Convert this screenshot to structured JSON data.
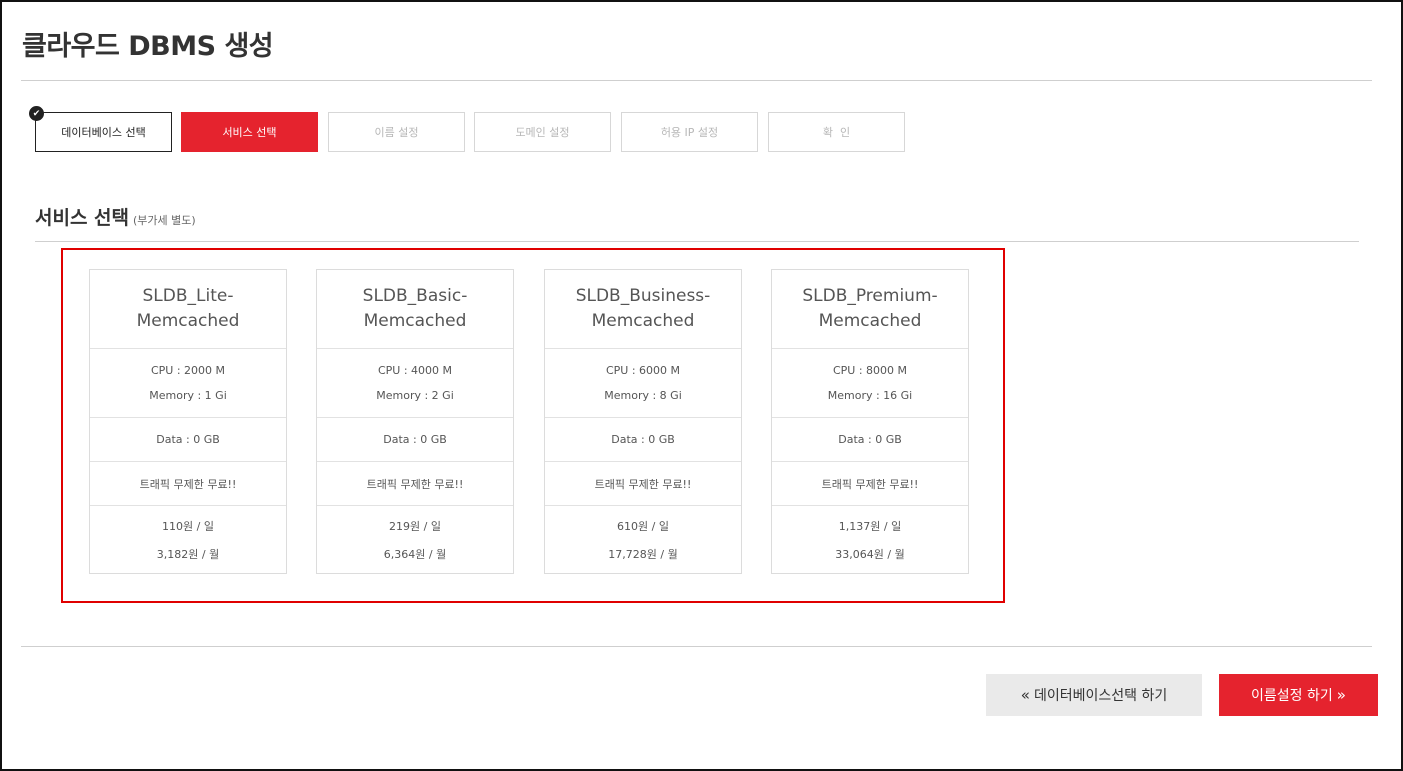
{
  "page": {
    "title": "클라우드 DBMS 생성",
    "accent_color": "#e5232e"
  },
  "steps": [
    {
      "label": "데이터베이스 선택",
      "state": "done"
    },
    {
      "label": "서비스 선택",
      "state": "active"
    },
    {
      "label": "이름 설정",
      "state": "pending"
    },
    {
      "label": "도메인 설정",
      "state": "pending"
    },
    {
      "label": "허용 IP 설정",
      "state": "pending"
    },
    {
      "label": "확  인",
      "state": "pending"
    }
  ],
  "section": {
    "title": "서비스 선택",
    "note": "(부가세 별도)"
  },
  "plans": [
    {
      "name_line1": "SLDB_Lite-",
      "name_line2": "Memcached",
      "cpu": "CPU : 2000 M",
      "memory": "Memory : 1 Gi",
      "data": "Data : 0 GB",
      "traffic": "트래픽 무제한 무료!!",
      "price_day": "110원 / 일",
      "price_month": "3,182원 / 월"
    },
    {
      "name_line1": "SLDB_Basic-",
      "name_line2": "Memcached",
      "cpu": "CPU : 4000 M",
      "memory": "Memory : 2 Gi",
      "data": "Data : 0 GB",
      "traffic": "트래픽 무제한 무료!!",
      "price_day": "219원 / 일",
      "price_month": "6,364원 / 월"
    },
    {
      "name_line1": "SLDB_Business-",
      "name_line2": "Memcached",
      "cpu": "CPU : 6000 M",
      "memory": "Memory : 8 Gi",
      "data": "Data : 0 GB",
      "traffic": "트래픽 무제한 무료!!",
      "price_day": "610원 / 일",
      "price_month": "17,728원 / 월"
    },
    {
      "name_line1": "SLDB_Premium-",
      "name_line2": "Memcached",
      "cpu": "CPU : 8000 M",
      "memory": "Memory : 16 Gi",
      "data": "Data : 0 GB",
      "traffic": "트래픽 무제한 무료!!",
      "price_day": "1,137원 / 일",
      "price_month": "33,064원 / 월"
    }
  ],
  "buttons": {
    "prev_label": "데이터베이스선택 하기",
    "next_label": "이름설정 하기"
  }
}
